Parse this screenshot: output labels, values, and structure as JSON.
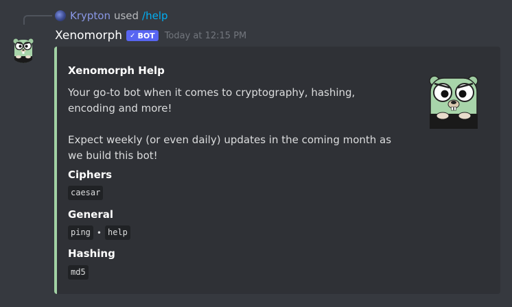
{
  "reply": {
    "user": "Krypton",
    "verb": "used",
    "command": "/help"
  },
  "message": {
    "username": "Xenomorph",
    "bot_badge": "BOT",
    "timestamp": "Today at 12:15 PM"
  },
  "embed": {
    "accent_color": "#a2d2a4",
    "title": "Xenomorph Help",
    "description": [
      "Your go-to bot when it comes to cryptography, hashing, encoding and more!",
      "Expect weekly (or even daily) updates in the coming month as we build this bot!"
    ],
    "fields": [
      {
        "name": "Ciphers",
        "values": [
          "caesar"
        ]
      },
      {
        "name": "General",
        "values": [
          "ping",
          "help"
        ]
      },
      {
        "name": "Hashing",
        "values": [
          "md5"
        ]
      }
    ],
    "separator": "•"
  },
  "icons": {
    "avatar": "gopher-avatar",
    "thumbnail": "gopher-thumbnail",
    "verified": "checkmark-icon"
  }
}
